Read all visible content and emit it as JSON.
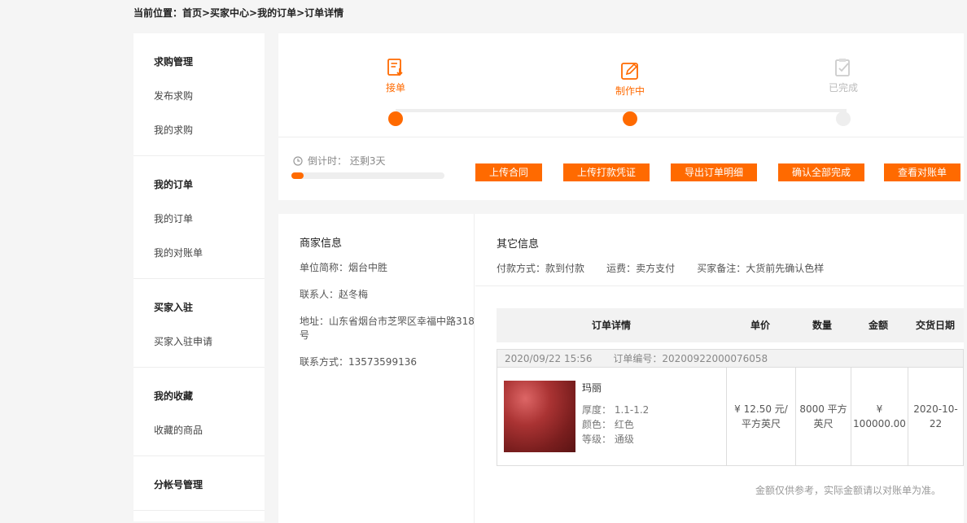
{
  "breadcrumb": "当前位置：首页>买家中心>我的订单>订单详情",
  "sidebar": [
    {
      "title": "求购管理",
      "items": [
        "发布求购",
        "我的求购"
      ]
    },
    {
      "title": "我的订单",
      "items": [
        "我的订单",
        "我的对账单"
      ]
    },
    {
      "title": "买家入驻",
      "items": [
        "买家入驻申请"
      ]
    },
    {
      "title": "我的收藏",
      "items": [
        "收藏的商品"
      ]
    },
    {
      "title": "分帐号管理",
      "items": []
    }
  ],
  "steps": [
    {
      "label": "接单",
      "state": "done",
      "icon": "document-download-icon"
    },
    {
      "label": "制作中",
      "state": "active",
      "icon": "pencil-edit-icon"
    },
    {
      "label": "已完成",
      "state": "pending",
      "icon": "clipboard-check-icon"
    }
  ],
  "countdown": {
    "label": "倒计时：  还剩3天",
    "progress": 0.08
  },
  "actions": [
    "上传合同",
    "上传打款凭证",
    "导出订单明细",
    "确认全部完成",
    "查看对账单"
  ],
  "merchant": {
    "heading": "商家信息",
    "short_name": "单位简称：烟台中胜",
    "contact": "联系人：赵冬梅",
    "address": "地址：山东省烟台市芝罘区幸福中路318号",
    "phone": "联系方式：13573599136"
  },
  "other": {
    "heading": "其它信息",
    "payment": "付款方式：款到付款",
    "shipping": "运费：卖方支付",
    "remark": "买家备注：大货前先确认色样"
  },
  "table": {
    "headers": [
      "订单详情",
      "单价",
      "数量",
      "金额",
      "交货日期"
    ],
    "order_time": "2020/09/22 15:56",
    "order_no": "订单编号：20200922000076058",
    "product": {
      "name": "玛丽",
      "thickness": "厚度： 1.1-1.2",
      "color": "颜色： 红色",
      "grade": "等级： 通级",
      "price": "¥ 12.50 元/平方英尺",
      "qty": "8000 平方英尺",
      "amount": "¥ 100000.00",
      "date": "2020-10-22"
    }
  },
  "note": "金额仅供参考，实际金额请以对账单为准。",
  "colors": {
    "accent": "#ff6a00",
    "pending": "#dddddd"
  }
}
